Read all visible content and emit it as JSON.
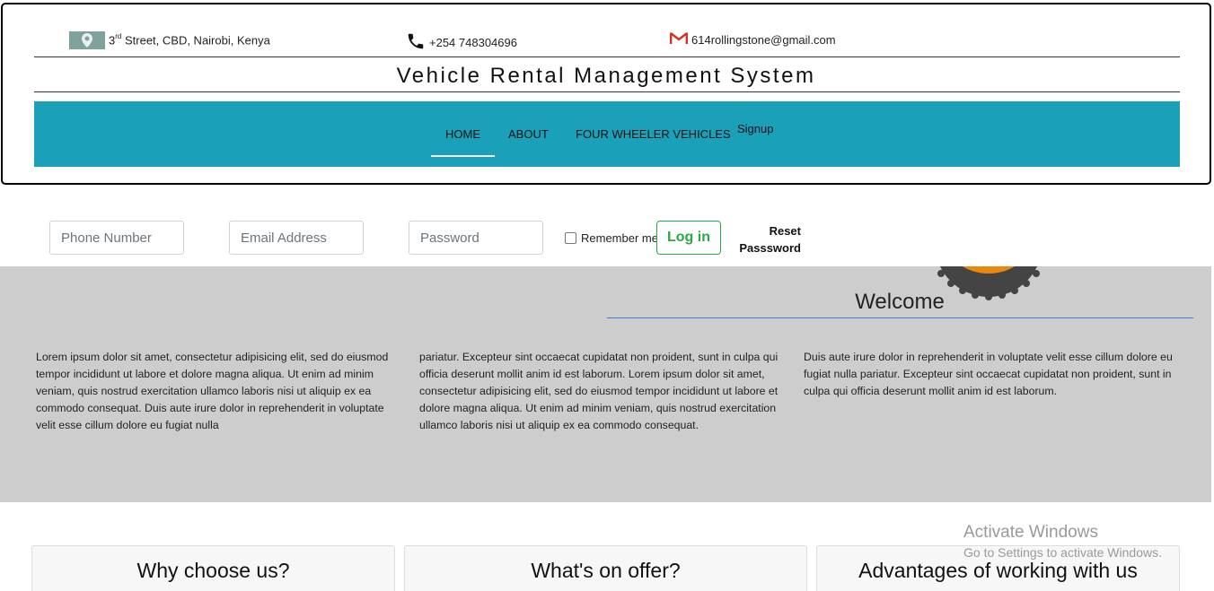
{
  "contact": {
    "address_ordinal": "3",
    "address_sup": "rd",
    "address_rest": " Street, CBD, Nairobi, Kenya",
    "phone": "+254 748304696",
    "email": "614rollingstone@gmail.com"
  },
  "header": {
    "title": "Vehicle Rental Management System"
  },
  "nav": {
    "items": [
      {
        "label": "HOME",
        "active": true
      },
      {
        "label": "ABOUT"
      },
      {
        "label": "FOUR WHEELER VEHICLES"
      },
      {
        "label": "Signup"
      }
    ]
  },
  "login": {
    "phone_placeholder": "Phone Number",
    "email_placeholder": "Email Address",
    "password_placeholder": "Password",
    "remember_label": "Remember me",
    "login_label": "Log in",
    "reset_line1": "Reset",
    "reset_line2": "Passsword"
  },
  "welcome": {
    "title": "Welcome",
    "columns": [
      "Lorem ipsum dolor sit amet, consectetur adipisicing elit, sed do eiusmod tempor incididunt ut labore et dolore magna aliqua. Ut enim ad minim veniam, quis nostrud exercitation ullamco laboris nisi ut aliquip ex ea commodo consequat. Duis aute irure dolor in reprehenderit in voluptate velit esse cillum dolore eu fugiat nulla",
      "pariatur. Excepteur sint occaecat cupidatat non proident, sunt in culpa qui officia deserunt mollit anim id est laborum. Lorem ipsum dolor sit amet, consectetur adipisicing elit, sed do eiusmod tempor incididunt ut labore et dolore magna aliqua. Ut enim ad minim veniam, quis nostrud exercitation ullamco laboris nisi ut aliquip ex ea commodo consequat.",
      "Duis aute irure dolor in reprehenderit in voluptate velit esse cillum dolore eu fugiat nulla pariatur. Excepteur sint occaecat cupidatat non proident, sunt in culpa qui officia deserunt mollit anim id est laborum."
    ]
  },
  "cards": [
    {
      "title": "Why choose us?"
    },
    {
      "title": "What's on offer?"
    },
    {
      "title": "Advantages of working with us"
    }
  ],
  "overlay": {
    "activate_title": "Activate Windows",
    "activate_sub": "Go to Settings to activate Windows."
  },
  "colors": {
    "navbar": "#1aa1b9",
    "welcome_bg": "#cdcdcd",
    "login_green": "#28a745",
    "badge_orange": "#e8890c"
  }
}
